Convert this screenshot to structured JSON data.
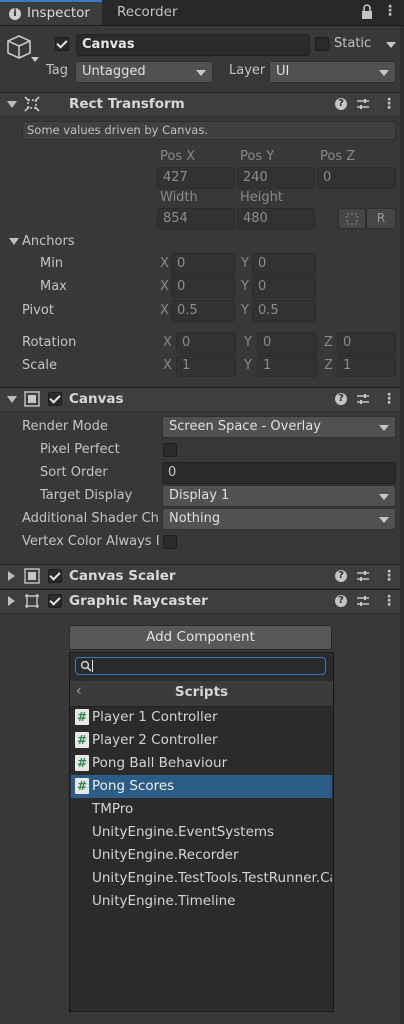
{
  "tabs": {
    "inspector": "Inspector",
    "recorder": "Recorder"
  },
  "header": {
    "object_name": "Canvas",
    "static_label": "Static",
    "tag_label": "Tag",
    "tag_value": "Untagged",
    "layer_label": "Layer",
    "layer_value": "UI"
  },
  "rect_transform": {
    "title": "Rect Transform",
    "note": "Some values driven by Canvas.",
    "pos_x_label": "Pos X",
    "pos_y_label": "Pos Y",
    "pos_z_label": "Pos Z",
    "pos_x": "427",
    "pos_y": "240",
    "pos_z": "0",
    "width_label": "Width",
    "height_label": "Height",
    "width": "854",
    "height": "480",
    "r_button": "R",
    "anchors_label": "Anchors",
    "min_label": "Min",
    "max_label": "Max",
    "min_x": "0",
    "min_y": "0",
    "max_x": "0",
    "max_y": "0",
    "pivot_label": "Pivot",
    "pivot_x": "0.5",
    "pivot_y": "0.5",
    "rotation_label": "Rotation",
    "rot_x": "0",
    "rot_y": "0",
    "rot_z": "0",
    "scale_label": "Scale",
    "scale_x": "1",
    "scale_y": "1",
    "scale_z": "1",
    "x": "X",
    "y": "Y",
    "z": "Z"
  },
  "canvas": {
    "title": "Canvas",
    "render_mode_label": "Render Mode",
    "render_mode": "Screen Space - Overlay",
    "pixel_perfect_label": "Pixel Perfect",
    "sort_order_label": "Sort Order",
    "sort_order": "0",
    "target_display_label": "Target Display",
    "target_display": "Display 1",
    "shader_label": "Additional Shader Ch",
    "shader_value": "Nothing",
    "vertex_label": "Vertex Color Always I"
  },
  "canvas_scaler": {
    "title": "Canvas Scaler"
  },
  "graphic_raycaster": {
    "title": "Graphic Raycaster"
  },
  "add_component": {
    "button": "Add Component",
    "search_value": "",
    "section_title": "Scripts",
    "items": [
      {
        "label": "Player 1 Controller",
        "icon": "csharp-script-icon"
      },
      {
        "label": "Player 2 Controller",
        "icon": "csharp-script-icon"
      },
      {
        "label": "Pong Ball Behaviour",
        "icon": "csharp-script-icon"
      },
      {
        "label": "Pong Scores",
        "icon": "csharp-script-icon",
        "selected": true
      },
      {
        "label": "TMPro"
      },
      {
        "label": "UnityEngine.EventSystems"
      },
      {
        "label": "UnityEngine.Recorder"
      },
      {
        "label": "UnityEngine.TestTools.TestRunner.Ca"
      },
      {
        "label": "UnityEngine.Timeline"
      }
    ]
  },
  "colors": {
    "accent": "#3a79bb",
    "selection": "#2c5d87",
    "background": "#383838"
  }
}
